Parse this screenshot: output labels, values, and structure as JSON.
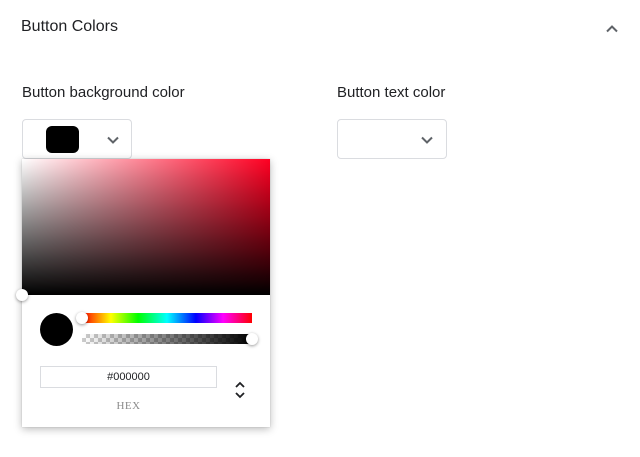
{
  "section": {
    "title": "Button Colors",
    "collapse_icon": "chevron-up-icon"
  },
  "background_color": {
    "label": "Button background color",
    "value": "#000000",
    "dropdown_icon": "chevron-down-icon"
  },
  "text_color": {
    "label": "Button text color",
    "dropdown_icon": "chevron-down-icon"
  },
  "picker": {
    "hue_color": "#ff0022",
    "hue_level": 0.0,
    "alpha_level": 1.0,
    "hex_value": "#000000",
    "mode_label": "HEX",
    "mode_toggle_icon": "up-down-chevrons-icon"
  }
}
